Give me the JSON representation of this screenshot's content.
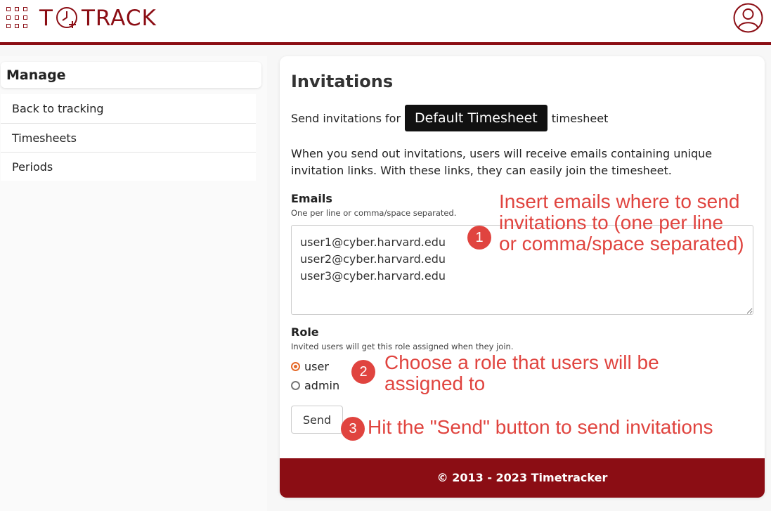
{
  "app": {
    "logo_prefix": "T",
    "logo_suffix": "TRACK"
  },
  "sidebar": {
    "title": "Manage",
    "items": [
      {
        "label": "Back to tracking"
      },
      {
        "label": "Timesheets"
      },
      {
        "label": "Periods"
      }
    ]
  },
  "main": {
    "title": "Invitations",
    "send_for_prefix": "Send invitations for",
    "timesheet_button": "Default Timesheet",
    "send_for_suffix": "timesheet",
    "description": "When you send out invitations, users will receive emails containing unique invitation links. With these links, they can easily join the timesheet.",
    "emails_label": "Emails",
    "emails_hint": "One per line or comma/space separated.",
    "emails_value": "user1@cyber.harvard.edu\nuser2@cyber.harvard.edu\nuser3@cyber.harvard.edu",
    "role_label": "Role",
    "role_hint": "Invited users will get this role assigned when they join.",
    "roles": [
      {
        "label": "user",
        "checked": true
      },
      {
        "label": "admin",
        "checked": false
      }
    ],
    "send_label": "Send",
    "footer": "© 2013 - 2023 Timetracker"
  },
  "annotations": [
    {
      "number": "1",
      "text": "Insert emails where to send invitations to (one per line or comma/space separated)"
    },
    {
      "number": "2",
      "text": "Choose a role that users will be assigned to"
    },
    {
      "number": "3",
      "text": "Hit the \"Send\" button to send invitations"
    }
  ],
  "colors": {
    "brand": "#8b0d14",
    "annotation": "#e0443f",
    "radio_checked": "#e56a2a"
  },
  "icons": [
    "apps-grid-icon",
    "clock-plus-icon",
    "user-avatar-icon"
  ]
}
